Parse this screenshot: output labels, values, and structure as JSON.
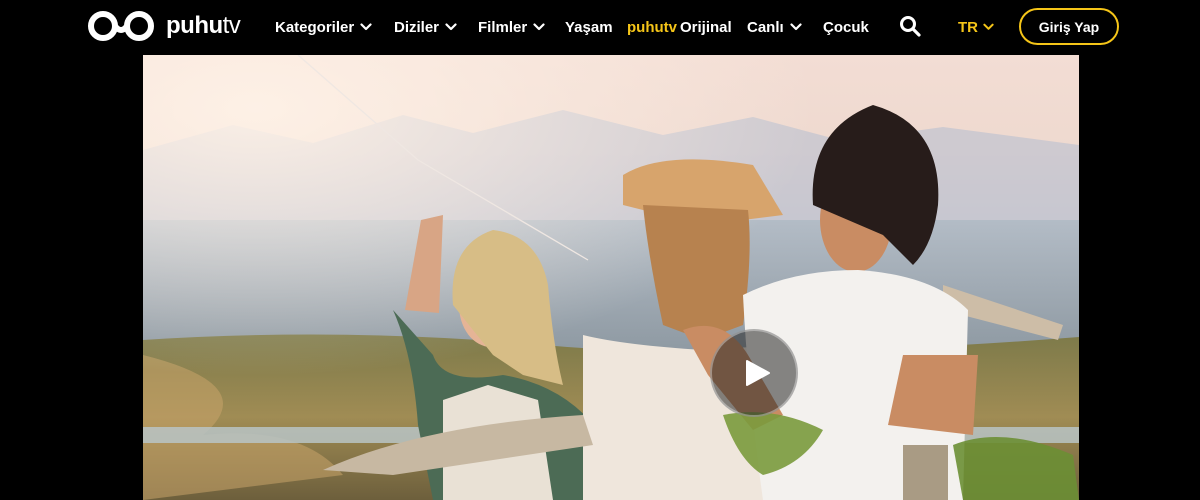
{
  "brand": {
    "logo_word_a": "puhu",
    "logo_word_b": "tv",
    "accent": "#f5c518"
  },
  "nav": {
    "items": [
      {
        "label": "Kategoriler",
        "has_dropdown": true
      },
      {
        "label": "Diziler",
        "has_dropdown": true
      },
      {
        "label": "Filmler",
        "has_dropdown": true
      },
      {
        "label": "Yaşam",
        "has_dropdown": false
      },
      {
        "label": "Orijinal",
        "brand_prefix": "puhutv",
        "has_dropdown": false
      },
      {
        "label": "Canlı",
        "has_dropdown": true
      },
      {
        "label": "Çocuk",
        "has_dropdown": false
      }
    ]
  },
  "header": {
    "search_icon": "search-icon",
    "language": "TR",
    "login_label": "Giriş Yap"
  },
  "hero": {
    "play_icon": "play-icon"
  }
}
